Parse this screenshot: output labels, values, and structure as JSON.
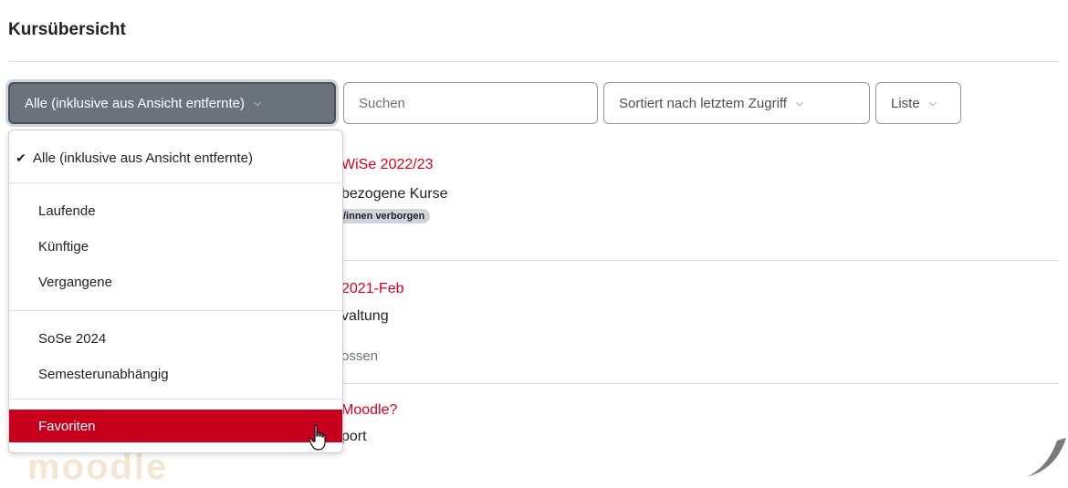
{
  "page": {
    "title": "Kursübersicht"
  },
  "toolbar": {
    "filter_label": "Alle (inklusive aus Ansicht entfernte)",
    "search_placeholder": "Suchen",
    "sort_label": "Sortiert nach letztem Zugriff",
    "view_label": "Liste"
  },
  "dropdown": {
    "items": [
      {
        "label": "Alle (inklusive aus Ansicht entfernte)",
        "checked": true
      },
      {
        "label": "Laufende"
      },
      {
        "label": "Künftige"
      },
      {
        "label": "Vergangene"
      },
      {
        "label": "SoSe 2024"
      },
      {
        "label": "Semesterunabhängig"
      },
      {
        "label": "Favoriten",
        "highlighted": true
      }
    ]
  },
  "courses": [
    {
      "title": "WiSe 2022/23",
      "category": "bezogene Kurse",
      "badge": "/innen verborgen"
    },
    {
      "title": "2021-Feb",
      "category": "valtung",
      "status": "ossen"
    },
    {
      "title": "Moodle?",
      "category": "port"
    }
  ],
  "colors": {
    "accent": "#c8001e",
    "link": "#d1001f",
    "button_dark": "#6a737b"
  },
  "icons": [
    "chevron-down-icon",
    "check-icon",
    "hand-cursor-icon"
  ]
}
